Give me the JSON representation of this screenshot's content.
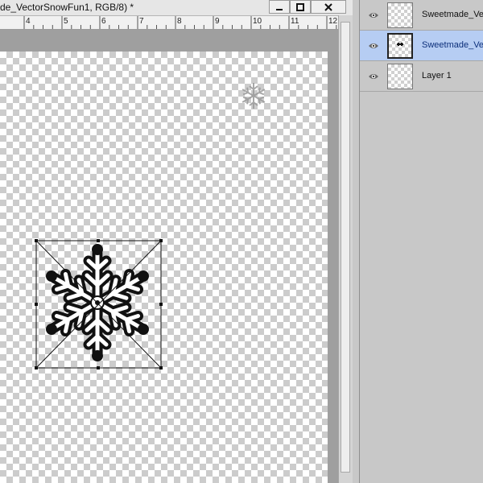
{
  "document": {
    "title": "de_VectorSnowFun1, RGB/8) *",
    "ruler_labels": [
      "4",
      "5",
      "6",
      "7",
      "8",
      "9",
      "10",
      "11",
      "12"
    ]
  },
  "window_controls": {
    "minimize": "minimize-icon",
    "maximize": "maximize-icon",
    "close": "close-icon"
  },
  "layers": [
    {
      "name": "Sweetmade_Ve",
      "visible": true,
      "selected": false
    },
    {
      "name": "Sweetmade_Ve",
      "visible": true,
      "selected": true
    },
    {
      "name": "Layer 1",
      "visible": true,
      "selected": false
    }
  ],
  "colors": {
    "selection": "#b6cdf3",
    "panel": "#c8c8c8",
    "workspace": "#9f9f9f"
  }
}
